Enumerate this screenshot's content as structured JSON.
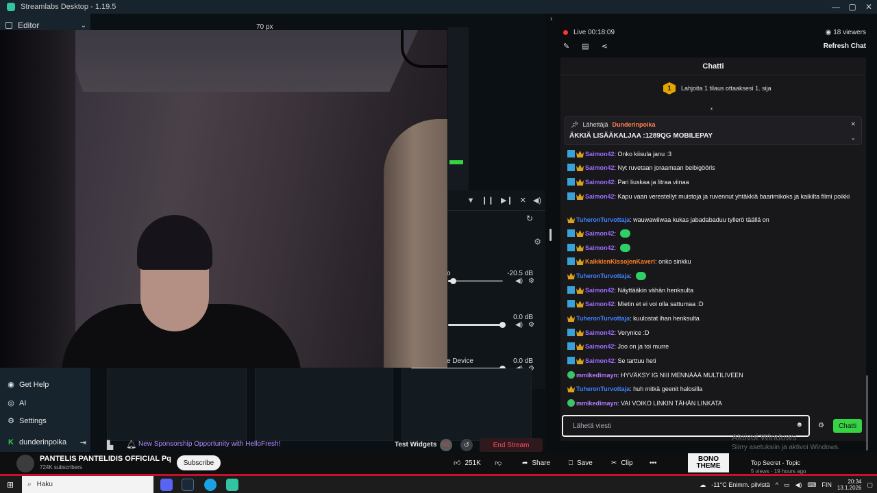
{
  "window": {
    "title": "Streamlabs Desktop - 1.19.5",
    "controls": [
      "—",
      "▢",
      "✕"
    ]
  },
  "sidebar": {
    "editor_label": "Editor",
    "items": [
      {
        "label": "Get Help",
        "icon": "help-icon"
      },
      {
        "label": "AI",
        "icon": "ai-icon"
      },
      {
        "label": "Settings",
        "icon": "gear-icon"
      }
    ],
    "user": "dunderinpoika"
  },
  "editor": {
    "px_label": "70 px"
  },
  "mixer": {
    "rows": [
      {
        "label": "o",
        "value": "-20.5 dB",
        "level": 0.1
      },
      {
        "label": "",
        "value": "0.0 dB",
        "level": 1.0
      },
      {
        "label": "e Device",
        "value": "0.0 dB",
        "level": 1.0
      }
    ]
  },
  "status_bar": {
    "sponsor_text": "New Sponsorship Opportunity with HelloFresh!",
    "test_widgets": "Test Widgets",
    "rec_label": "REC",
    "end_stream": "End Stream"
  },
  "chat_panel": {
    "live_time": "Live 00:18:09",
    "viewers": "18 viewers",
    "refresh_label": "Refresh Chat",
    "header": "Chatti",
    "gift_rank": "1",
    "gift_text": "Lahjoita 1 tilaus ottaaksesi 1. sija",
    "pinned": {
      "sender_label": "Lähettäjä",
      "sender_name": "Dunderinpoika",
      "message": "ÄKKIÄ LISÄÄKALJAA :1289QG MOBILEPAY"
    },
    "messages": [
      {
        "user": "Saimon42",
        "color": "#9c6cff",
        "badges": [
          "mod",
          "sub"
        ],
        "text": ": Onko kiisula janu :3"
      },
      {
        "user": "Saimon42",
        "color": "#9c6cff",
        "badges": [
          "mod",
          "sub"
        ],
        "text": ": Nyt ruvetaan joraamaan beibigöörls"
      },
      {
        "user": "Saimon42",
        "color": "#9c6cff",
        "badges": [
          "mod",
          "sub"
        ],
        "text": ": Pari liuskaa ja litraa viinaa"
      },
      {
        "user": "Saimon42",
        "color": "#9c6cff",
        "badges": [
          "mod",
          "sub"
        ],
        "text": ": Kapu vaan verestellyt muistoja ja ruvennut yhtäkkiä baarimikoks ja kaikilta filmi poikki"
      },
      {
        "user": "TuheronTurvottaja",
        "color": "#3f82ff",
        "badges": [
          "sub"
        ],
        "text": ": wauwawiiwaa kukas jabadabaduu tyllerö täällä on"
      },
      {
        "user": "Saimon42",
        "color": "#9c6cff",
        "badges": [
          "mod",
          "sub"
        ],
        "text": ":",
        "emote": true
      },
      {
        "user": "Saimon42",
        "color": "#9c6cff",
        "badges": [
          "mod",
          "sub"
        ],
        "text": ":",
        "emote": true
      },
      {
        "user": "KaikkienKissojenKaveri",
        "color": "#ff7f24",
        "badges": [
          "mod",
          "sub"
        ],
        "text": ": onko sinkku"
      },
      {
        "user": "TuheronTurvottaja",
        "color": "#3f82ff",
        "badges": [
          "sub"
        ],
        "text": ":",
        "emote": true
      },
      {
        "user": "Saimon42",
        "color": "#9c6cff",
        "badges": [
          "mod",
          "sub"
        ],
        "text": ": Näyttääkin vähän henksulta"
      },
      {
        "user": "Saimon42",
        "color": "#9c6cff",
        "badges": [
          "mod",
          "sub"
        ],
        "text": ": Mietin et ei voi olla sattumaa :D"
      },
      {
        "user": "TuheronTurvottaja",
        "color": "#3f82ff",
        "badges": [
          "sub"
        ],
        "text": ": kuulostat ihan henksulta"
      },
      {
        "user": "Saimon42",
        "color": "#9c6cff",
        "badges": [
          "mod",
          "sub"
        ],
        "text": ": Verynice :D"
      },
      {
        "user": "Saimon42",
        "color": "#9c6cff",
        "badges": [
          "mod",
          "sub"
        ],
        "text": ": Joo on ja toi murre"
      },
      {
        "user": "Saimon42",
        "color": "#9c6cff",
        "badges": [
          "mod",
          "sub"
        ],
        "text": ": Se tarttuu heti"
      },
      {
        "user": "mmikedimayn",
        "color": "#b57cff",
        "badges": [
          "green"
        ],
        "text": ": HYVÄKSY IG NIII MENNÄÄÄ MULTILIVEEN"
      },
      {
        "user": "TuheronTurvottaja",
        "color": "#3f82ff",
        "badges": [
          "sub"
        ],
        "text": ": huh mitkä geenit halosilla"
      },
      {
        "user": "mmikedimayn",
        "color": "#b57cff",
        "badges": [
          "green"
        ],
        "text": ": VAI VOIKO LINKIN TÄHÄN LINKATA"
      }
    ],
    "input_placeholder": "Lähetä viesti",
    "send_label": "Chatti",
    "watermark_title": "Aktivoi Windows",
    "watermark_sub": "Siirry asetuksiin ja aktivoi Windows."
  },
  "youtube": {
    "channel": "PANTELIS PANTELIDIS OFFICIAL Pq",
    "subscribers": "724K subscribers",
    "subscribe": "Subscribe",
    "likes": "251K",
    "share": "Share",
    "save": "Save",
    "clip": "Clip",
    "thumb_text": "BONO THEME",
    "track_title": "Top Secret - Topic",
    "track_meta": "5 views · 19 hours ago"
  },
  "taskbar": {
    "search_placeholder": "Haku",
    "weather": "-11°C  Enimm. pilvistä",
    "lang": "FIN",
    "time": "20:34",
    "date": "13.1.2026"
  }
}
